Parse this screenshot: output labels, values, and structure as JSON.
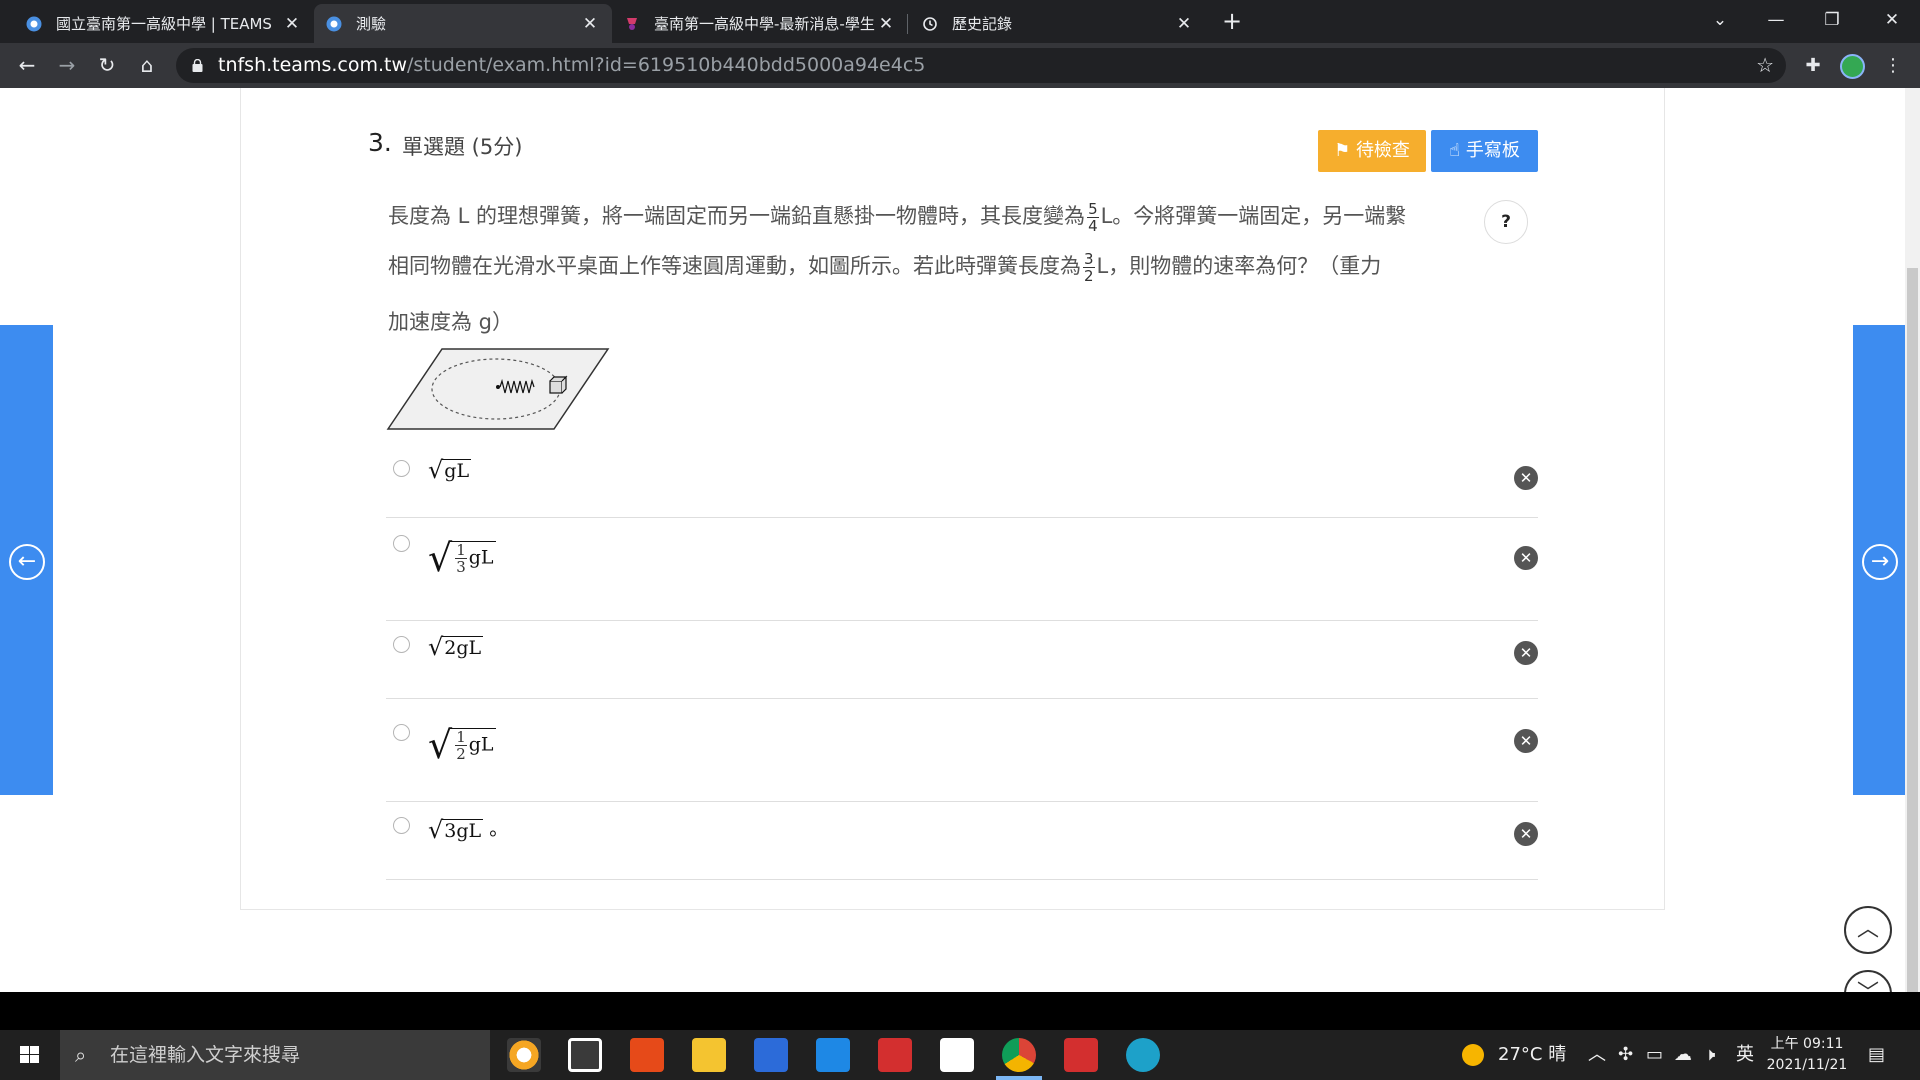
{
  "tabs": [
    {
      "title": "國立臺南第一高級中學 | TEAMS",
      "close": "✕"
    },
    {
      "title": "測驗",
      "close": "✕"
    },
    {
      "title": "臺南第一高級中學-最新消息-學生",
      "close": "✕"
    },
    {
      "title": "歷史記錄",
      "close": "✕"
    }
  ],
  "new_tab": "+",
  "address": {
    "host": "tnfsh.teams.com.tw",
    "path": "/student/exam.html?id=619510b440bdd5000a94e4c5"
  },
  "question": {
    "number": "3.",
    "type": "單選題 (5分)",
    "check_button": "待檢查",
    "pad_button": "手寫板",
    "help": "?",
    "line1_a": "長度為 L 的理想彈簧，將一端固定而另一端鉛直懸掛一物體時，其長度變為",
    "frac1_num": "5",
    "frac1_den": "4",
    "line1_b": "L。今將彈簧一端固定，另一端繫",
    "line2_a": "相同物體在光滑水平桌面上作等速圓周運動，如圖所示。若此時彈簧長度為",
    "frac2_num": "3",
    "frac2_den": "2",
    "line2_b": "L，則物體的速率為何？（重力",
    "line3": "加速度為 g）"
  },
  "options": [
    {
      "radicand": "gL",
      "suffix": ""
    },
    {
      "frac_num": "1",
      "frac_den": "3",
      "tail": "gL",
      "suffix": ""
    },
    {
      "radicand": "2gL",
      "suffix": ""
    },
    {
      "frac_num": "1",
      "frac_den": "2",
      "tail": "gL",
      "suffix": ""
    },
    {
      "radicand": "3gL",
      "suffix": "。"
    }
  ],
  "taskbar": {
    "search_placeholder": "在這裡輸入文字來搜尋",
    "weather": "27°C 晴",
    "ime": "英",
    "time": "上午 09:11",
    "date": "2021/11/21"
  },
  "colors": {
    "accent_blue": "#3d8cf0",
    "accent_orange": "#f6ae2d"
  }
}
